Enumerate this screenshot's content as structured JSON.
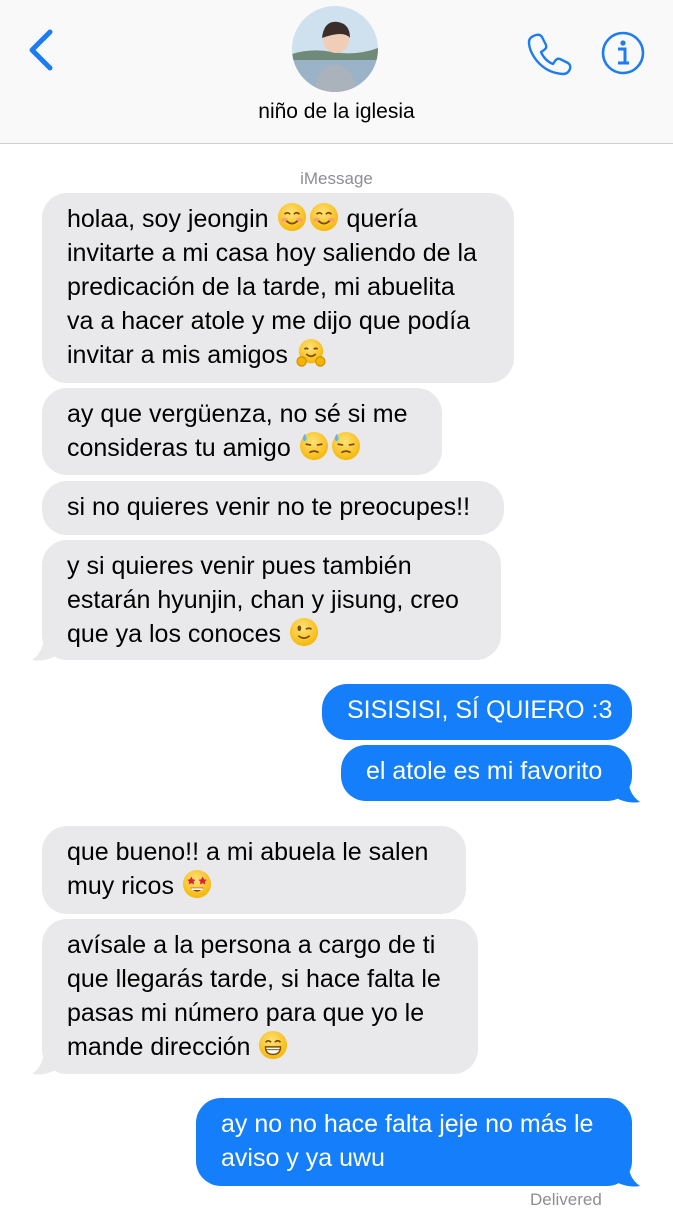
{
  "header": {
    "contact_name": "niño de la iglesia"
  },
  "service_label": "iMessage",
  "messages": {
    "m1": {
      "l1": "holaa, soy jeongin",
      "l1b": "quería",
      "l2": "invitarte a mi casa hoy saliendo de la",
      "l3": "predicación de la tarde, mi abuelita",
      "l4": "va a hacer atole y me dijo que podía",
      "l5": "invitar a mis amigos"
    },
    "m2": {
      "l1": "ay que vergüenza, no sé si me",
      "l2": "consideras tu amigo"
    },
    "m3": {
      "l1": "si no quieres venir no te preocupes!!"
    },
    "m4": {
      "l1": "y si quieres venir pues también",
      "l2": "estarán hyunjin, chan y jisung, creo",
      "l3": "que ya los conoces"
    },
    "m5": {
      "l1": "SISISISI, SÍ QUIERO :3"
    },
    "m6": {
      "l1": "el atole es mi favorito"
    },
    "m7": {
      "l1": "que bueno!! a mi abuela le salen",
      "l2": "muy ricos"
    },
    "m8": {
      "l1": "avísale a la persona a cargo de ti",
      "l2": "que llegarás tarde, si hace falta le",
      "l3": "pasas mi número para que yo le",
      "l4": "mande dirección"
    },
    "m9": {
      "l1": "ay no no hace falta jeje no más le",
      "l2": "aviso y ya uwu"
    }
  },
  "emojis": [
    "smiling-face-icon",
    "hugging-face-icon",
    "downcast-sweat-face-icon",
    "winking-face-icon",
    "star-struck-face-icon",
    "grinning-face-icon"
  ],
  "status": {
    "delivered": "Delivered"
  },
  "colors": {
    "accent": "#147efb",
    "incoming_bubble": "#e9e9eb",
    "nav_blue": "#1e7cf2"
  }
}
